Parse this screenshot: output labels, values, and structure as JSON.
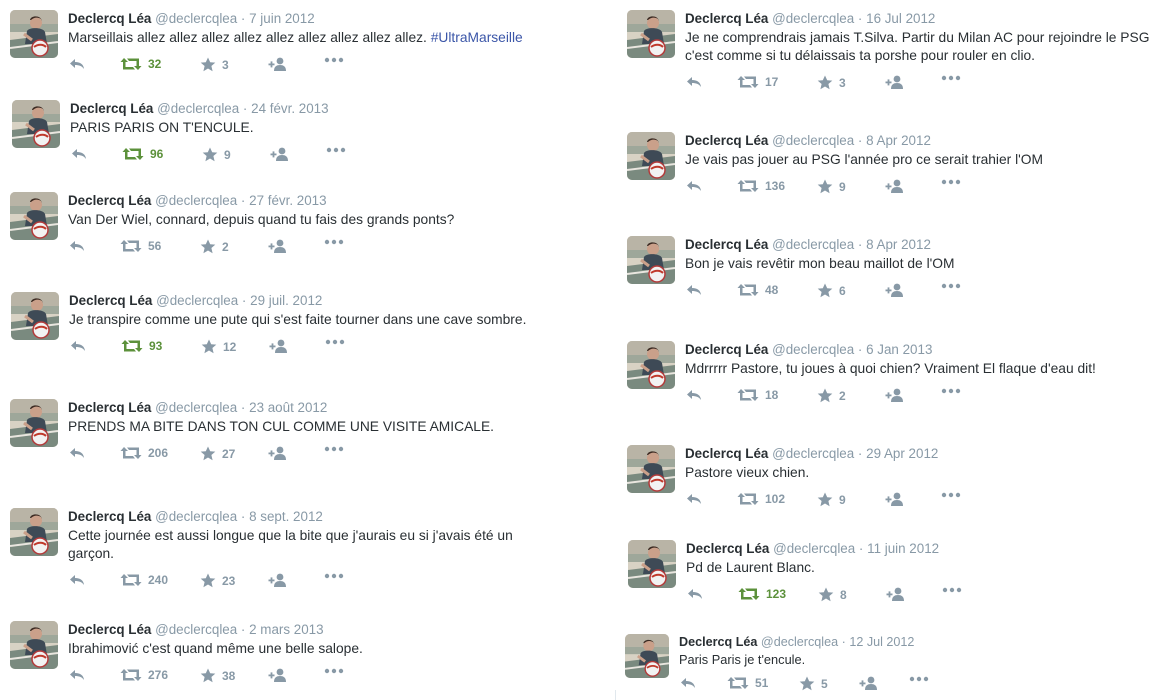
{
  "user": {
    "name": "Declercq Léa",
    "handle": "@declercqlea"
  },
  "left_tweets": [
    {
      "date": "7 juin 2012",
      "text": "Marseillais allez allez allez allez allez allez allez allez allez.",
      "hashtag": "#UltraMarseille",
      "retweets": "32",
      "favorites": "3",
      "retweeted": true
    },
    {
      "date": "24 févr. 2013",
      "text": "PARIS PARIS ON T'ENCULE.",
      "hashtag": "",
      "retweets": "96",
      "favorites": "9",
      "retweeted": true
    },
    {
      "date": "27 févr. 2013",
      "text": "Van Der Wiel, connard, depuis quand tu fais des grands ponts?",
      "hashtag": "",
      "retweets": "56",
      "favorites": "2",
      "retweeted": false
    },
    {
      "date": "29 juil. 2012",
      "text": "Je transpire comme une pute qui s'est faite tourner dans une cave sombre.",
      "hashtag": "",
      "retweets": "93",
      "favorites": "12",
      "retweeted": true
    },
    {
      "date": "23 août 2012",
      "text": "PRENDS MA BITE DANS TON CUL COMME UNE VISITE AMICALE.",
      "hashtag": "",
      "retweets": "206",
      "favorites": "27",
      "retweeted": false
    },
    {
      "date": "8 sept. 2012",
      "text": "Cette journée est aussi longue que la bite que j'aurais eu si j'avais été un garçon.",
      "hashtag": "",
      "retweets": "240",
      "favorites": "23",
      "retweeted": false
    },
    {
      "date": "2 mars 2013",
      "text": "Ibrahimović c'est quand même une belle salope.",
      "hashtag": "",
      "retweets": "276",
      "favorites": "38",
      "retweeted": false
    }
  ],
  "right_tweets": [
    {
      "date": "16 Jul 2012",
      "text": "Je ne comprendrais jamais T.Silva. Partir du Milan AC pour rejoindre le PSG c'est comme si tu délaissais ta porshe pour rouler en clio.",
      "hashtag": "",
      "retweets": "17",
      "favorites": "3",
      "retweeted": false
    },
    {
      "date": "8 Apr 2012",
      "text": "Je vais pas jouer au PSG l'année pro ce serait trahier l'OM",
      "hashtag": "",
      "retweets": "136",
      "favorites": "9",
      "retweeted": false
    },
    {
      "date": "8 Apr 2012",
      "text": "Bon je vais revêtir mon beau maillot de l'OM",
      "hashtag": "",
      "retweets": "48",
      "favorites": "6",
      "retweeted": false
    },
    {
      "date": "6 Jan 2013",
      "text": "Mdrrrrr Pastore, tu joues à quoi chien? Vraiment El flaque d'eau dit!",
      "hashtag": "",
      "retweets": "18",
      "favorites": "2",
      "retweeted": false
    },
    {
      "date": "29 Apr 2012",
      "text": "Pastore vieux chien.",
      "hashtag": "",
      "retweets": "102",
      "favorites": "9",
      "retweeted": false
    },
    {
      "date": "11 juin 2012",
      "text": "Pd de Laurent Blanc.",
      "hashtag": "",
      "retweets": "123",
      "favorites": "8",
      "retweeted": true
    },
    {
      "date": "12 Jul 2012",
      "text": "Paris Paris je t'encule.",
      "hashtag": "",
      "retweets": "51",
      "favorites": "5",
      "retweeted": false
    }
  ],
  "colors": {
    "retweet_active": "#5c913b",
    "meta": "#8899a6",
    "hashtag": "#3b56a8",
    "text": "#292f33"
  },
  "icons": {
    "reply": "reply-icon",
    "retweet": "retweet-icon",
    "favorite": "star-icon",
    "follow": "follow-icon",
    "more": "more-icon"
  }
}
